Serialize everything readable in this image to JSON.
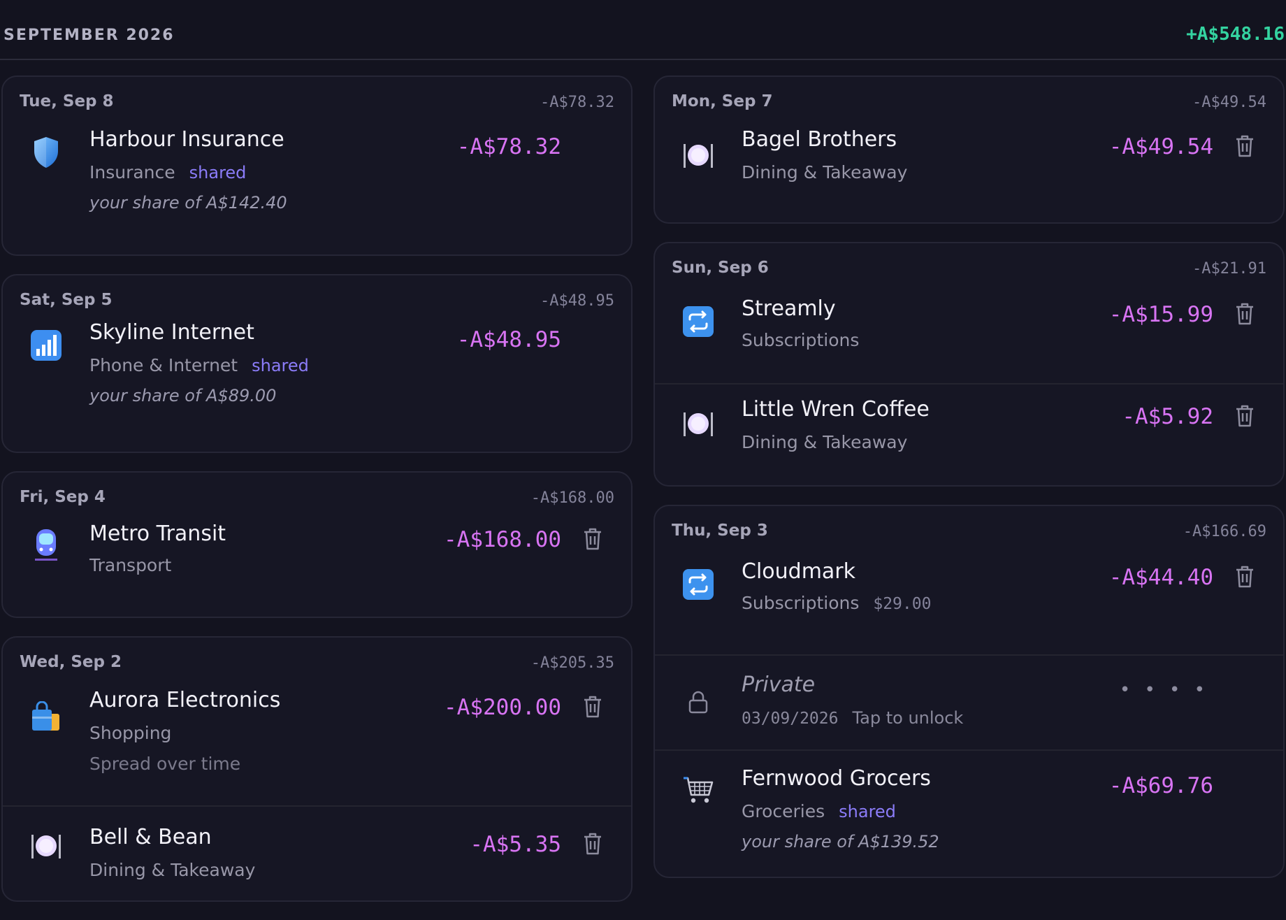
{
  "header": {
    "month": "SEPTEMBER 2026",
    "net_total": "+A$548.16"
  },
  "colors": {
    "positive": "#34d3a0",
    "expense": "#d874f3",
    "shared": "#8b7cf8"
  },
  "left_days": [
    {
      "label": "Tue, Sep 8",
      "total": "-A$78.32",
      "txns": [
        {
          "icon": "shield-icon",
          "name": "Harbour Insurance",
          "category": "Insurance",
          "shared": "shared",
          "share_note": "your share of A$142.40",
          "amount": "-A$78.32"
        }
      ]
    },
    {
      "label": "Sat, Sep 5",
      "total": "-A$48.95",
      "txns": [
        {
          "icon": "bar-chart-icon",
          "name": "Skyline Internet",
          "category": "Phone & Internet",
          "shared": "shared",
          "share_note": "your share of A$89.00",
          "amount": "-A$48.95"
        }
      ]
    },
    {
      "label": "Fri, Sep 4",
      "total": "-A$168.00",
      "txns": [
        {
          "icon": "metro-icon",
          "name": "Metro Transit",
          "category": "Transport",
          "amount": "-A$168.00"
        }
      ]
    },
    {
      "label": "Wed, Sep 2",
      "total": "-A$205.35",
      "txns": [
        {
          "icon": "shopping-bags-icon",
          "name": "Aurora Electronics",
          "category": "Shopping",
          "note": "Spread over time",
          "amount": "-A$200.00"
        },
        {
          "icon": "plate-cutlery-icon",
          "name": "Bell & Bean",
          "category": "Dining & Takeaway",
          "amount": "-A$5.35"
        }
      ]
    }
  ],
  "right_days": [
    {
      "label": "Mon, Sep 7",
      "total": "-A$49.54",
      "txns": [
        {
          "icon": "plate-cutlery-icon",
          "name": "Bagel Brothers",
          "category": "Dining & Takeaway",
          "amount": "-A$49.54"
        }
      ]
    },
    {
      "label": "Sun, Sep 6",
      "total": "-A$21.91",
      "txns": [
        {
          "icon": "repeat-icon",
          "name": "Streamly",
          "category": "Subscriptions",
          "amount": "-A$15.99"
        },
        {
          "icon": "plate-cutlery-icon",
          "name": "Little Wren Coffee",
          "category": "Dining & Takeaway",
          "amount": "-A$5.92"
        }
      ]
    },
    {
      "label": "Thu, Sep 3",
      "total": "-A$166.69",
      "txns": [
        {
          "icon": "repeat-icon",
          "name": "Cloudmark",
          "category": "Subscriptions",
          "original": "$29.00",
          "amount": "-A$44.40"
        },
        {
          "icon": "lock-icon",
          "private_title": "Private",
          "date": "03/09/2026",
          "unlock_hint": "Tap to unlock",
          "masked": "• • • •"
        },
        {
          "icon": "shopping-cart-icon",
          "name": "Fernwood Grocers",
          "category": "Groceries",
          "shared": "shared",
          "share_note": "your share of A$139.52",
          "amount": "-A$69.76"
        }
      ]
    }
  ]
}
